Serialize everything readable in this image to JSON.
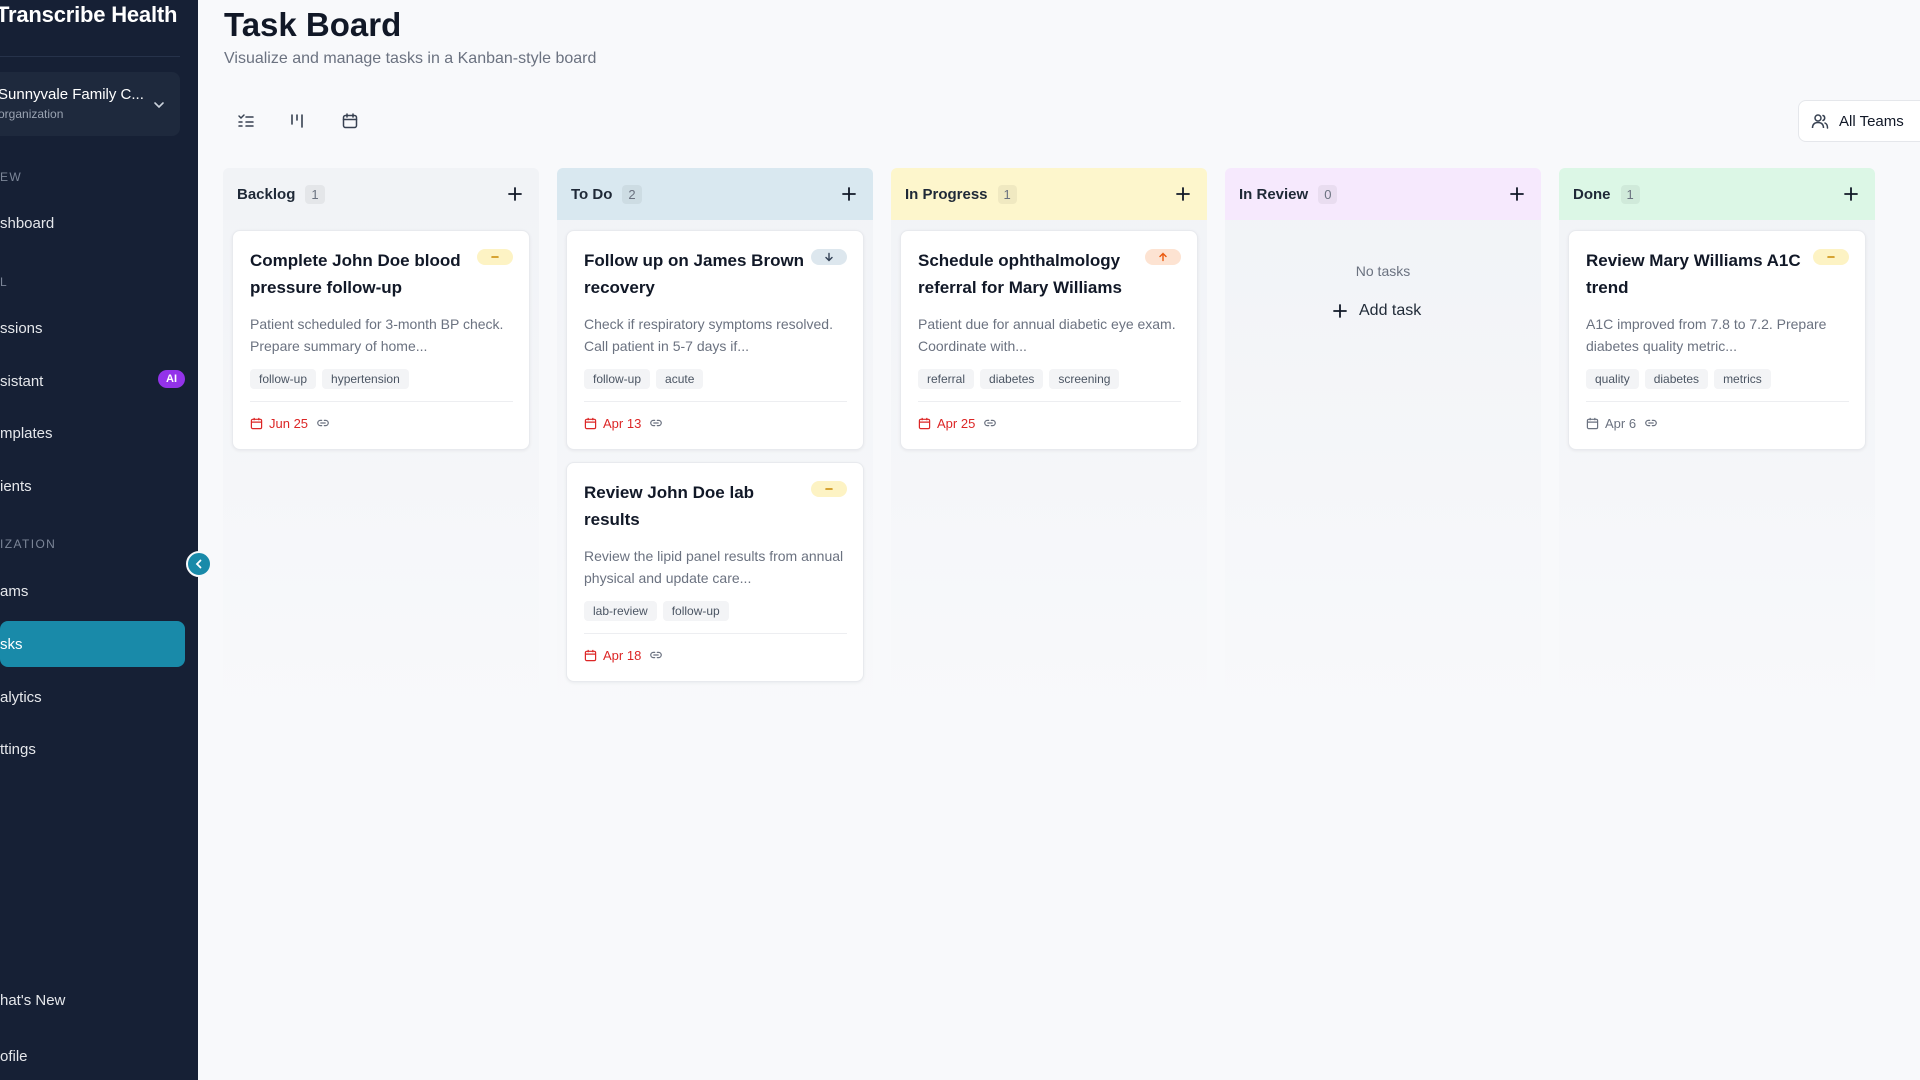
{
  "sidebar": {
    "brand": "Transcribe Health",
    "org": {
      "name": "Sunnyvale Family C...",
      "sub": "organization"
    },
    "sections": [
      "EW",
      "L",
      "IZATION"
    ],
    "items": [
      {
        "label": "shboard"
      },
      {
        "label": "ssions"
      },
      {
        "label": "sistant",
        "badge": "AI"
      },
      {
        "label": "mplates"
      },
      {
        "label": "ients"
      },
      {
        "label": "ams"
      },
      {
        "label": "sks"
      },
      {
        "label": "alytics"
      },
      {
        "label": "ttings"
      }
    ],
    "footer": [
      {
        "label": "hat's New"
      },
      {
        "label": "ofile"
      }
    ]
  },
  "header": {
    "title": "Task Board",
    "subtitle": "Visualize and manage tasks in a Kanban-style board",
    "teams_label": "All Teams"
  },
  "colors": {
    "accent": "#198aa9",
    "backlog": "#f1f3f6",
    "todo": "#d9e8f0",
    "in_progress": "#fdf6cc",
    "in_review": "#f6e9fd",
    "done": "#dcf7e6",
    "overdue": "#dc2626"
  },
  "columns": [
    {
      "title": "Backlog",
      "count": "1",
      "cards": [
        {
          "title": "Complete John Doe blood pressure follow-up",
          "desc": "Patient scheduled for 3-month BP check. Prepare summary of home...",
          "tags": [
            "follow-up",
            "hypertension"
          ],
          "due": "Jun 25",
          "priority": "medium"
        }
      ]
    },
    {
      "title": "To Do",
      "count": "2",
      "cards": [
        {
          "title": "Follow up on James Brown recovery",
          "desc": "Check if respiratory symptoms resolved. Call patient in 5-7 days if...",
          "tags": [
            "follow-up",
            "acute"
          ],
          "due": "Apr 13",
          "priority": "low"
        },
        {
          "title": "Review John Doe lab results",
          "desc": "Review the lipid panel results from annual physical and update care...",
          "tags": [
            "lab-review",
            "follow-up"
          ],
          "due": "Apr 18",
          "priority": "medium"
        }
      ]
    },
    {
      "title": "In Progress",
      "count": "1",
      "cards": [
        {
          "title": "Schedule ophthalmology referral for Mary Williams",
          "desc": "Patient due for annual diabetic eye exam. Coordinate with...",
          "tags": [
            "referral",
            "diabetes",
            "screening"
          ],
          "due": "Apr 25",
          "priority": "high"
        }
      ]
    },
    {
      "title": "In Review",
      "count": "0",
      "empty_text": "No tasks",
      "add_label": "Add task"
    },
    {
      "title": "Done",
      "count": "1",
      "cards": [
        {
          "title": "Review Mary Williams A1C trend",
          "desc": "A1C improved from 7.8 to 7.2. Prepare diabetes quality metric...",
          "tags": [
            "quality",
            "diabetes",
            "metrics"
          ],
          "due": "Apr 6",
          "priority": "medium"
        }
      ]
    }
  ]
}
